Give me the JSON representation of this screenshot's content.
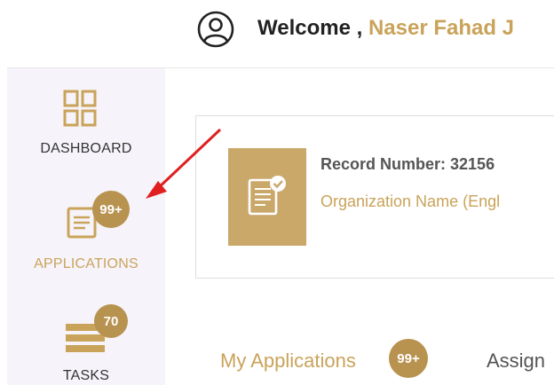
{
  "header": {
    "welcome_prefix": "Welcome , ",
    "user_name": "Naser Fahad J",
    "avatar_icon": "user-circle-icon"
  },
  "sidebar": {
    "items": [
      {
        "label": "DASHBOARD",
        "icon": "grid-icon",
        "active": false
      },
      {
        "label": "APPLICATIONS",
        "icon": "document-icon",
        "badge": "99+",
        "active": true
      },
      {
        "label": "TASKS",
        "icon": "tasks-icon",
        "badge": "70",
        "active": false
      }
    ]
  },
  "record": {
    "number_label": "Record Number: 32156",
    "organization_label": "Organization Name (Engl",
    "icon": "certificate-icon"
  },
  "tabs": [
    {
      "label": "My Applications",
      "badge": "99+",
      "active": true
    },
    {
      "label": "Assign",
      "active": false
    }
  ],
  "annotation": {
    "icon": "red-arrow-icon",
    "color": "#e02020"
  },
  "colors": {
    "gold": "#c9a35a",
    "badge": "#b8924f",
    "sidebar_bg": "#f6f4fa"
  }
}
